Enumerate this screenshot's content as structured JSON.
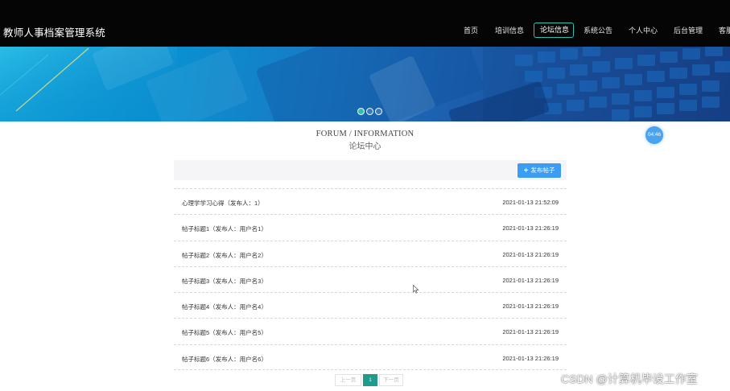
{
  "app": {
    "title": "教师人事档案管理系统"
  },
  "nav": {
    "items": [
      {
        "label": "首页",
        "active": false
      },
      {
        "label": "培训信息",
        "active": false
      },
      {
        "label": "论坛信息",
        "active": true
      },
      {
        "label": "系统公告",
        "active": false
      },
      {
        "label": "个人中心",
        "active": false
      },
      {
        "label": "后台管理",
        "active": false
      },
      {
        "label": "客服",
        "active": false
      }
    ]
  },
  "banner": {
    "slides": 3,
    "active_slide": 1
  },
  "section": {
    "title_en": "FORUM / INFORMATION",
    "title_cn": "论坛中心"
  },
  "timer": {
    "text": "04:46"
  },
  "toolbar": {
    "post_label": "发布帖子",
    "post_icon": "plus-icon"
  },
  "posts": [
    {
      "title": "心理学学习心得（发布人：1）",
      "time": "2021-01-13 21:52:09"
    },
    {
      "title": "帖子标题1（发布人：用户名1）",
      "time": "2021-01-13 21:26:19"
    },
    {
      "title": "帖子标题2（发布人：用户名2）",
      "time": "2021-01-13 21:26:19"
    },
    {
      "title": "帖子标题3（发布人：用户名3）",
      "time": "2021-01-13 21:26:19"
    },
    {
      "title": "帖子标题4（发布人：用户名4）",
      "time": "2021-01-13 21:26:19"
    },
    {
      "title": "帖子标题5（发布人：用户名5）",
      "time": "2021-01-13 21:26:19"
    },
    {
      "title": "帖子标题6（发布人：用户名6）",
      "time": "2021-01-13 21:26:19"
    }
  ],
  "pagination": {
    "prev_label": "上一页",
    "current": "1",
    "next_label": "下一页"
  },
  "watermark": {
    "text": "CSDN @计算机毕设工作室"
  },
  "colors": {
    "accent": "#1e9b8a",
    "button": "#3b9cf2",
    "topbar": "#050505"
  }
}
